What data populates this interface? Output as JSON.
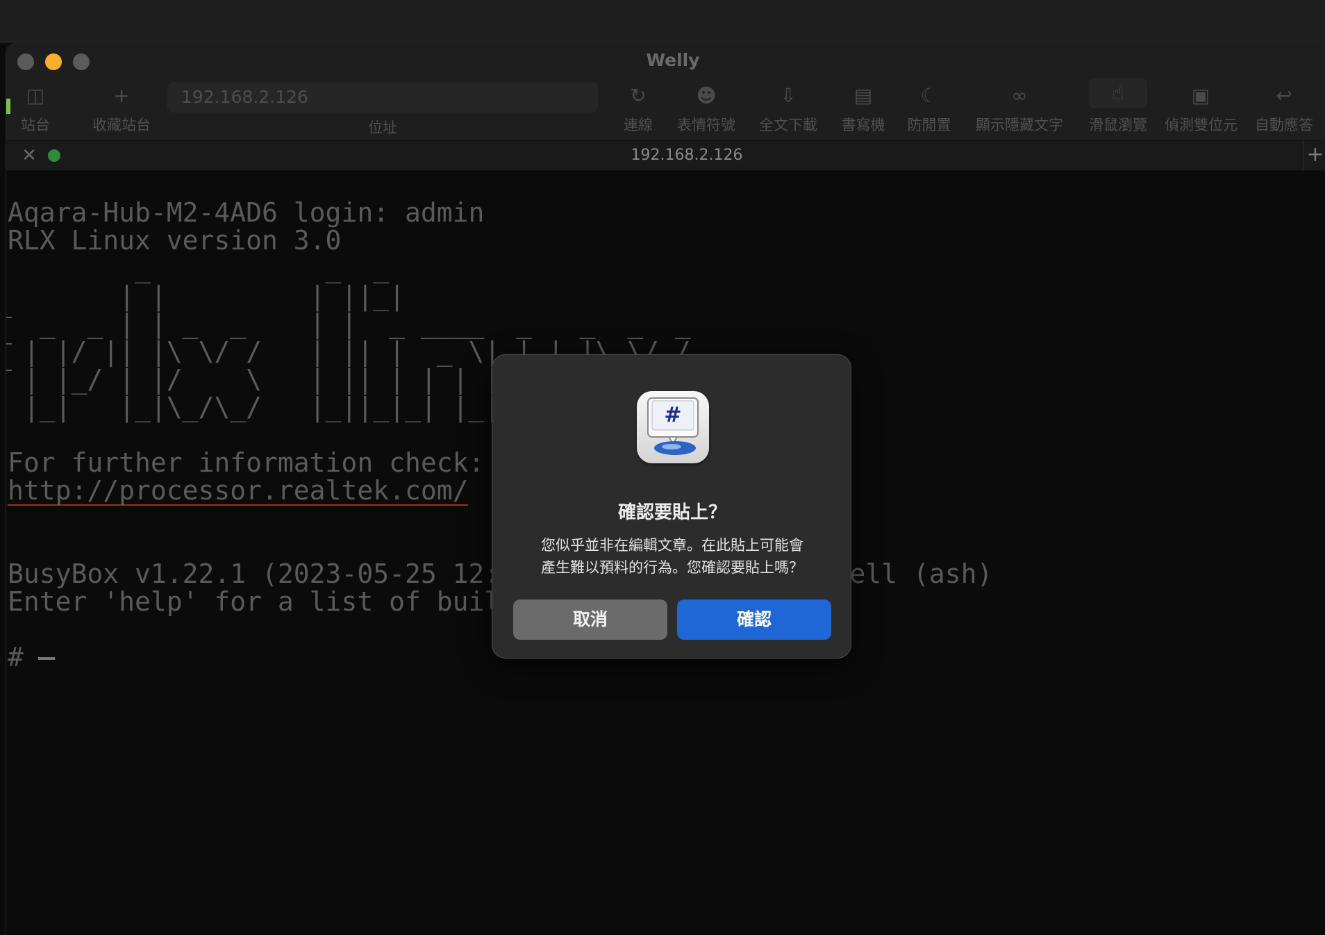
{
  "window": {
    "title": "Welly"
  },
  "toolbar": {
    "address_value": "192.168.2.126",
    "address_label": "位址",
    "items": [
      {
        "label": "站台",
        "icon": "book-icon"
      },
      {
        "label": "收藏站台",
        "icon": "plus-icon"
      },
      {
        "label": "連線",
        "icon": "reload-icon"
      },
      {
        "label": "表情符號",
        "icon": "smiley-icon"
      },
      {
        "label": "全文下載",
        "icon": "download-icon"
      },
      {
        "label": "書寫機",
        "icon": "compose-icon"
      },
      {
        "label": "防閒置",
        "icon": "coffee-icon"
      },
      {
        "label": "顯示隱藏文字",
        "icon": "glasses-icon"
      },
      {
        "label": "滑鼠瀏覽",
        "icon": "hand-pointer-icon"
      },
      {
        "label": "偵測雙位元",
        "icon": "double-byte-icon"
      },
      {
        "label": "自動應答",
        "icon": "reply-icon"
      }
    ]
  },
  "tab": {
    "title": "192.168.2.126"
  },
  "terminal": {
    "lines": [
      "Aqara-Hub-M2-4AD6 login: admin",
      "RLX Linux version 3.0",
      "        _           _  _",
      "       | |         | ||_|",
      "  _  _ | | _  _    | |  _ ____  _   _  _  _",
      " | |/ || |\\ \\/ /   | || |  _ \\| | | |\\ \\/ /",
      " | |_/ | |/    \\   | || | | | | |_| |/    \\",
      " |_|   |_|\\_/\\_/   |_||_|_| |_|\\____|\\_/\\_/",
      "",
      "For further information check:",
      "http://processor.realtek.com/",
      "",
      "",
      "BusyBox v1.22.1 (2023-05-25 12:06:16 CST) built-in shell (ash)",
      "Enter 'help' for a list of built-in commands.",
      "",
      "#"
    ]
  },
  "dialog": {
    "title": "確認要貼上？",
    "message_line1": "您似乎並非在編輯文章。在此貼上可能會",
    "message_line2": "產生難以預料的行為。您確認要貼上嗎？",
    "cancel_label": "取消",
    "confirm_label": "確認"
  },
  "colors": {
    "accent": "#1f66d6",
    "minimize": "#f6b129",
    "connected": "#2f8a3c"
  }
}
